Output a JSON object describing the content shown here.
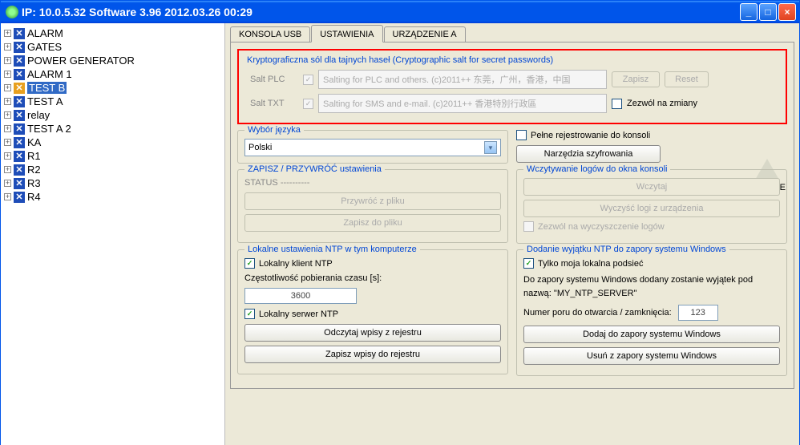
{
  "titlebar": {
    "text": "IP: 10.0.5.32   Software 3.96  2012.03.26  00:29"
  },
  "tree": [
    {
      "icon": "blue",
      "label": "ALARM"
    },
    {
      "icon": "blue",
      "label": "GATES"
    },
    {
      "icon": "blue",
      "label": "POWER GENERATOR"
    },
    {
      "icon": "blue",
      "label": "ALARM 1"
    },
    {
      "icon": "orange",
      "label": "TEST B",
      "selected": true
    },
    {
      "icon": "blue",
      "label": "TEST A"
    },
    {
      "icon": "blue",
      "label": "relay"
    },
    {
      "icon": "blue",
      "label": "TEST A 2"
    },
    {
      "icon": "blue",
      "label": "KA"
    },
    {
      "icon": "blue",
      "label": "R1"
    },
    {
      "icon": "blue",
      "label": "R2"
    },
    {
      "icon": "blue",
      "label": "R3"
    },
    {
      "icon": "blue",
      "label": "R4"
    }
  ],
  "tabs": [
    "KONSOLA USB",
    "USTAWIENIA",
    "URZĄDZENIE A"
  ],
  "salt": {
    "title": "Kryptograficzna sól dla tajnych haseł (Cryptographic salt for secret passwords)",
    "plc_label": "Salt PLC",
    "plc_value": "Salting for PLC and others. (c)2011++ 东莞，广州，香港，中国",
    "txt_label": "Salt TXT",
    "txt_value": "Salting for SMS and e-mail. (c)2011++ 香港特別行政區",
    "save": "Zapisz",
    "reset": "Reset",
    "allow_changes": "Zezwól na zmiany"
  },
  "lang": {
    "title": "Wybór języka",
    "value": "Polski"
  },
  "right_top": {
    "full_log": "Pełne rejestrowanie do konsoli",
    "encrypt": "Narzędzia szyfrowania",
    "offline": "OFFLINE"
  },
  "sr": {
    "title": "ZAPISZ / PRZYWRÓĆ ustawienia",
    "status_label": "STATUS ----------",
    "restore": "Przywróć z pliku",
    "save": "Zapisz do pliku"
  },
  "logload": {
    "title": "Wczytywanie logów do okna konsoli",
    "load": "Wczytaj",
    "clear": "Wyczyść logi z urządzenia",
    "allow": "Zezwól na wyczyszczenie logów"
  },
  "ntp_local": {
    "title": "Lokalne ustawienia NTP w tym komputerze",
    "client": "Lokalny klient NTP",
    "freq_label": "Częstotliwość pobierania czasu [s]:",
    "freq_value": "3600",
    "server": "Lokalny serwer NTP",
    "read": "Odczytaj wpisy z rejestru",
    "write": "Zapisz wpisy do rejestru"
  },
  "ntp_fw": {
    "title": "Dodanie wyjątku NTP do zapory systemu Windows",
    "subnet": "Tylko moja lokalna podsieć",
    "desc": "Do zapory systemu Windows dodany zostanie wyjątek pod nazwą: \"MY_NTP_SERVER\"",
    "port_label": "Numer poru do otwarcia / zamknięcia:",
    "port_value": "123",
    "add": "Dodaj do zapory systemu Windows",
    "remove": "Usuń z zapory systemu Windows"
  }
}
